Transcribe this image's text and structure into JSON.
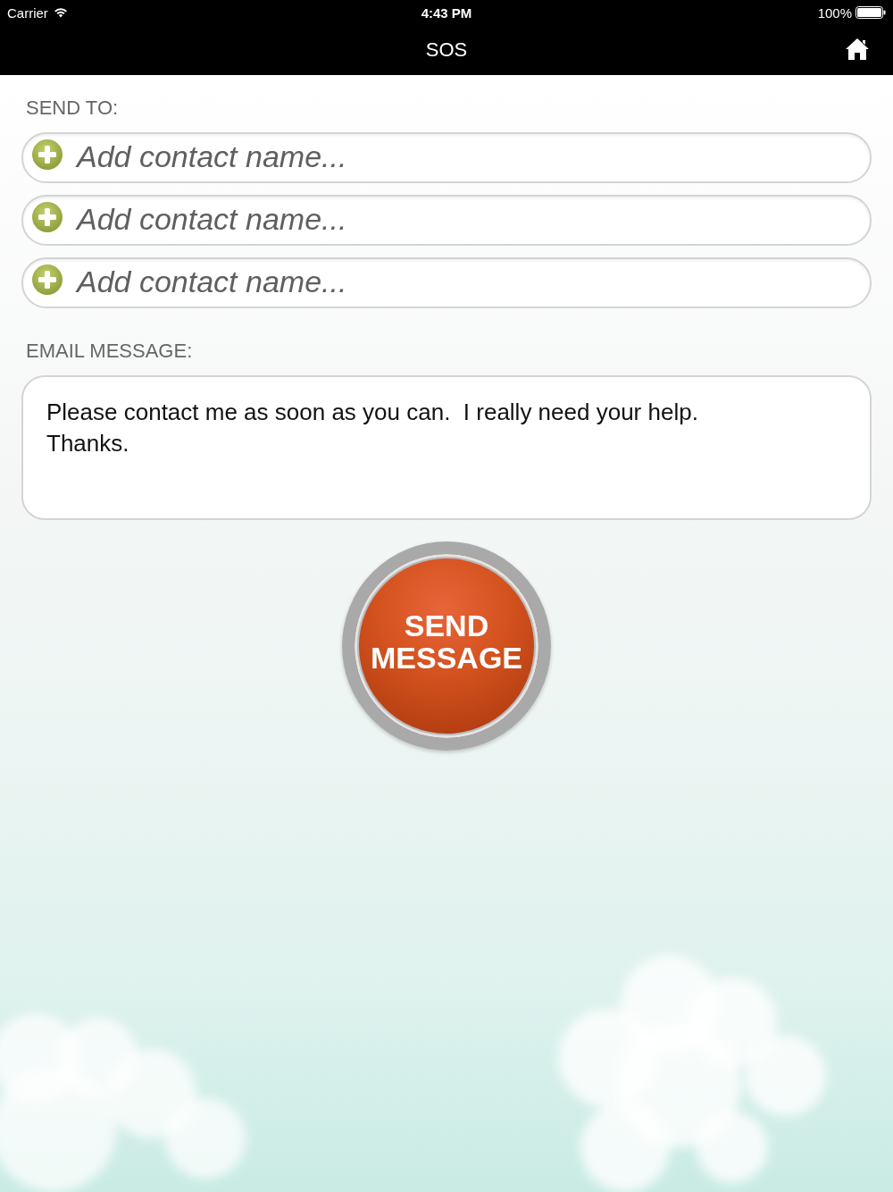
{
  "status_bar": {
    "carrier": "Carrier",
    "time": "4:43 PM",
    "battery": "100%"
  },
  "nav_bar": {
    "title": "SOS"
  },
  "send_to": {
    "label": "SEND TO:",
    "contacts": [
      {
        "placeholder": "Add contact name..."
      },
      {
        "placeholder": "Add contact name..."
      },
      {
        "placeholder": "Add contact name..."
      }
    ]
  },
  "email_message": {
    "label": "EMAIL MESSAGE:",
    "value": "Please contact me as soon as you can.  I really need your help.\nThanks."
  },
  "send_button": {
    "label_lines": [
      "SEND",
      "MESSAGE"
    ]
  }
}
